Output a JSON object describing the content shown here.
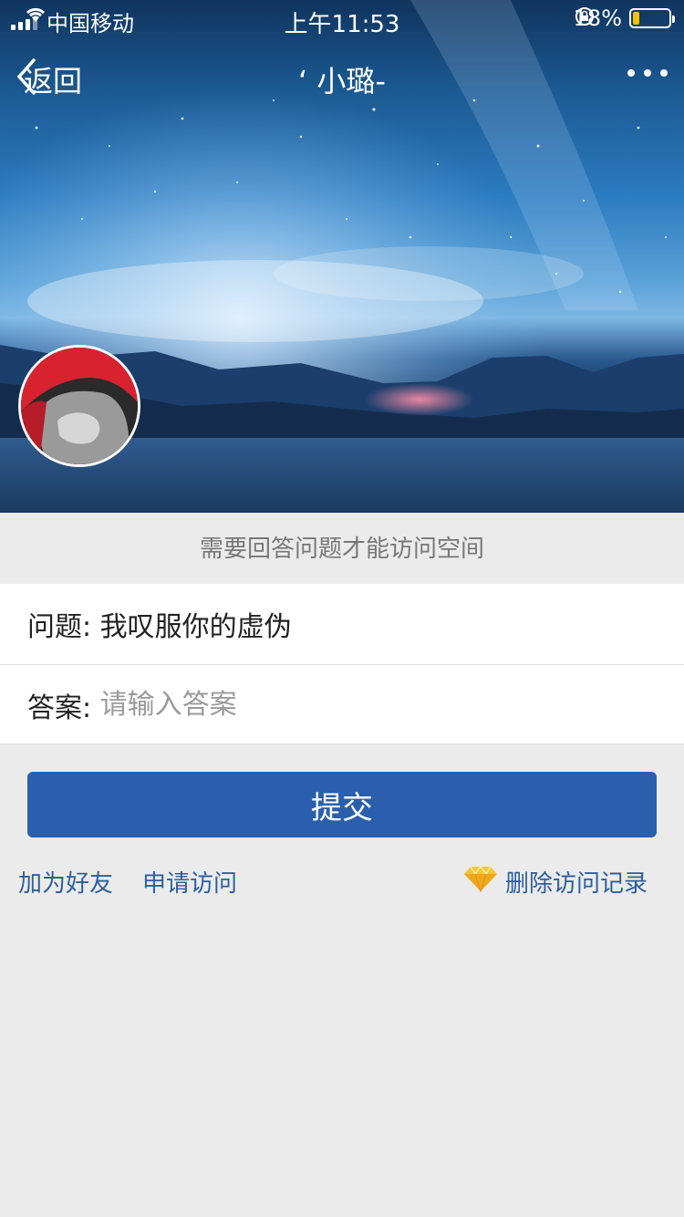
{
  "status_bar": {
    "carrier": "中国移动",
    "time": "上午11:53",
    "battery_percent": "18%",
    "battery_level": 0.18,
    "icons": [
      "signal-icon",
      "wifi-icon",
      "rotation-lock-icon",
      "battery-icon"
    ]
  },
  "nav": {
    "back_label": "返回",
    "title": "‘ 小璐-",
    "more_icon": "more-icon"
  },
  "notice": "需要回答问题才能访问空间",
  "question": {
    "label": "问题: ",
    "text": "我叹服你的虚伪"
  },
  "answer": {
    "label": "答案: ",
    "placeholder": "请输入答案",
    "value": ""
  },
  "submit_label": "提交",
  "links": {
    "add_friend": "加为好友",
    "request_access": "申请访问",
    "delete_records": "删除访问记录"
  },
  "colors": {
    "accent": "#2b5fad",
    "link": "#2d5f9e",
    "background": "#ebebeb",
    "battery": "#f3c300"
  }
}
